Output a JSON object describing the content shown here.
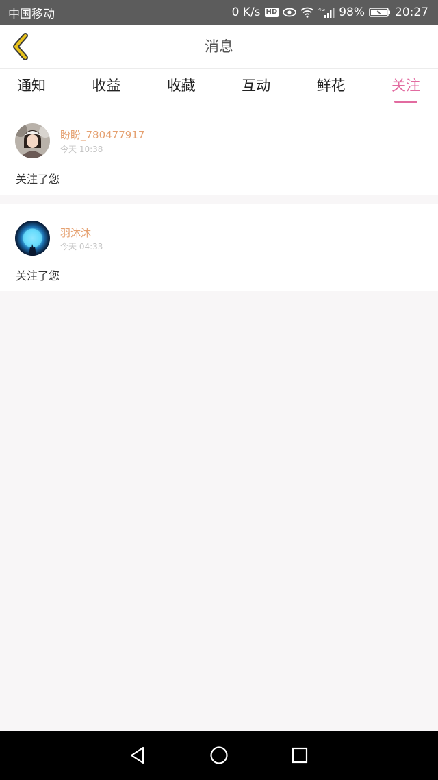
{
  "status_bar": {
    "carrier": "中国移动",
    "speed": "0 K/s",
    "hd": "HD",
    "network": "4G",
    "battery": "98%",
    "time": "20:27"
  },
  "header": {
    "title": "消息",
    "back_icon": "chevron-left-icon"
  },
  "tabs": [
    {
      "label": "通知",
      "active": false
    },
    {
      "label": "收益",
      "active": false
    },
    {
      "label": "收藏",
      "active": false
    },
    {
      "label": "互动",
      "active": false
    },
    {
      "label": "鲜花",
      "active": false
    },
    {
      "label": "关注",
      "active": true
    }
  ],
  "messages": [
    {
      "name": "盼盼_780477917",
      "time": "今天 10:38",
      "text": "关注了您"
    },
    {
      "name": "羽沐沐",
      "time": "今天 04:33",
      "text": "关注了您"
    }
  ],
  "colors": {
    "accent": "#e26ba0",
    "username": "#e5a171",
    "back_icon": "#e8c21c"
  },
  "nav_bar": {
    "back_icon": "triangle-back-icon",
    "home_icon": "circle-home-icon",
    "recents_icon": "square-recents-icon"
  }
}
